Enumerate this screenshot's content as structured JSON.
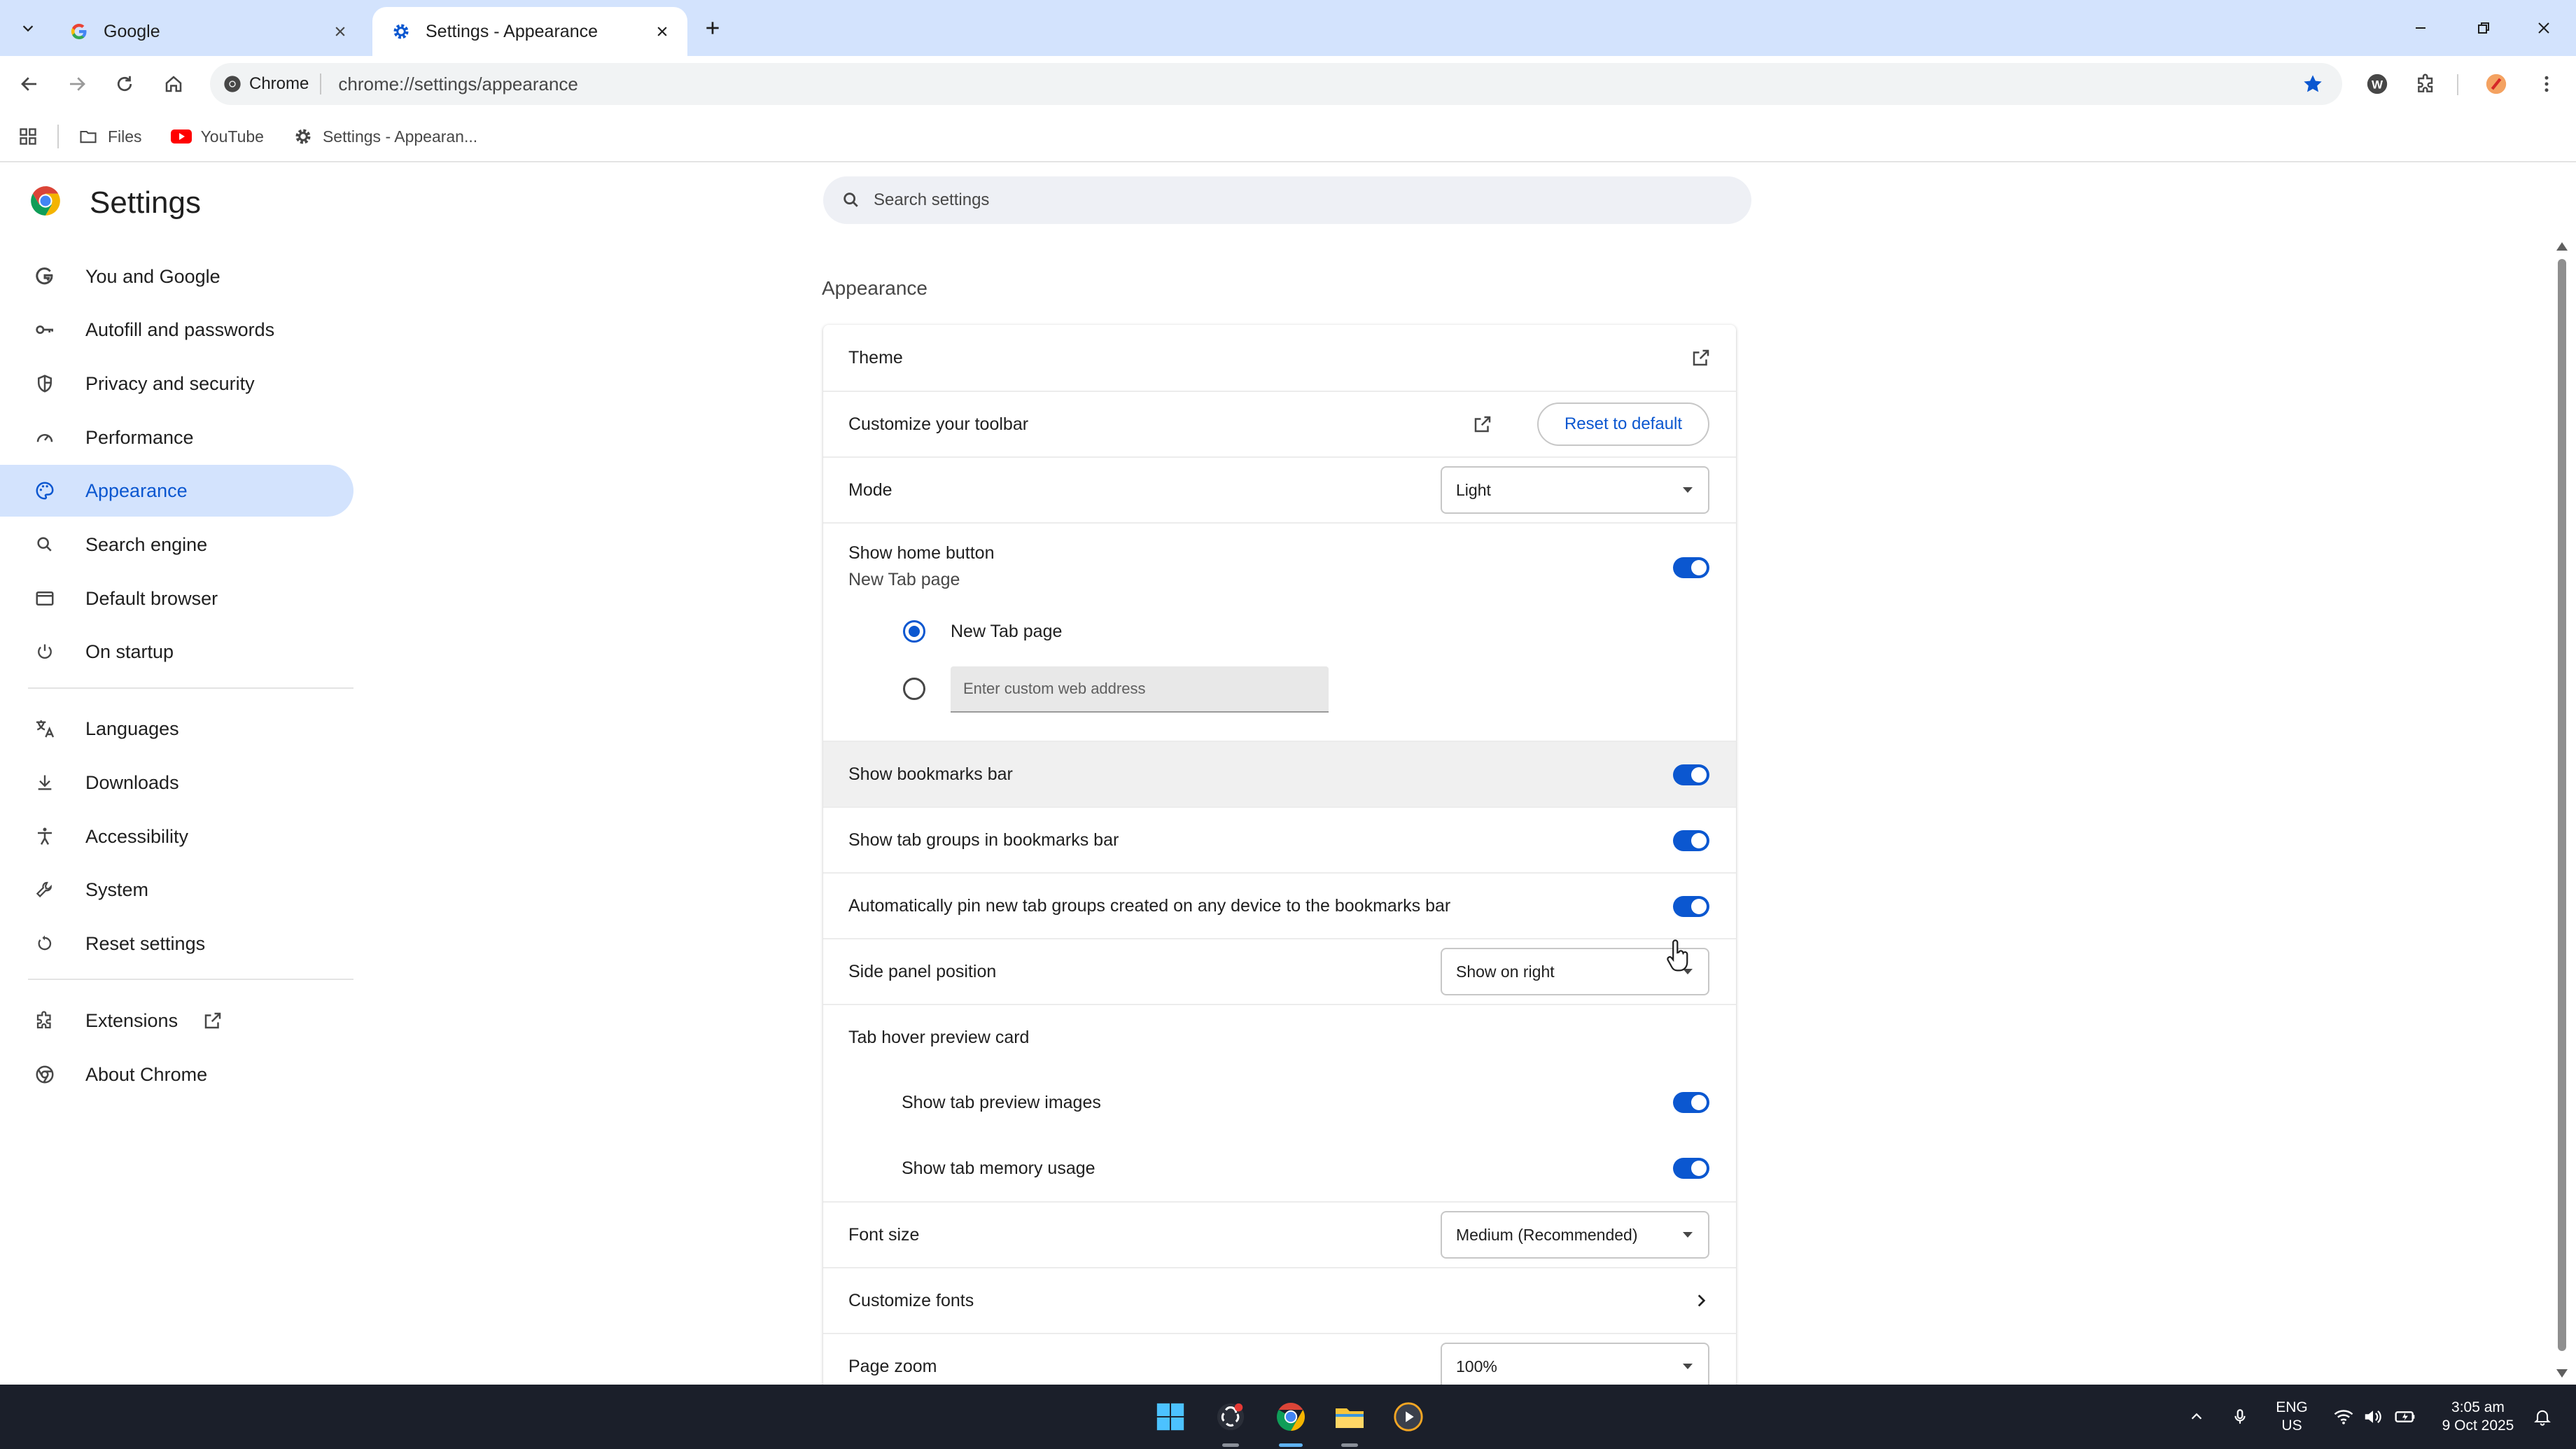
{
  "browser": {
    "tabs": [
      {
        "title": "Google",
        "active": false
      },
      {
        "title": "Settings - Appearance",
        "active": true
      }
    ],
    "omnibox": {
      "chip": "Chrome",
      "url": "chrome://settings/appearance"
    },
    "bookmarks": [
      {
        "label": "Files",
        "icon": "folder-icon"
      },
      {
        "label": "YouTube",
        "icon": "youtube-icon"
      },
      {
        "label": "Settings - Appearan...",
        "icon": "gear-icon"
      }
    ]
  },
  "settings": {
    "title": "Settings",
    "search_placeholder": "Search settings",
    "nav": [
      {
        "label": "You and Google",
        "icon": "google-g-icon"
      },
      {
        "label": "Autofill and passwords",
        "icon": "key-icon"
      },
      {
        "label": "Privacy and security",
        "icon": "shield-icon"
      },
      {
        "label": "Performance",
        "icon": "speedometer-icon"
      },
      {
        "label": "Appearance",
        "icon": "palette-icon",
        "active": true
      },
      {
        "label": "Search engine",
        "icon": "search-icon"
      },
      {
        "label": "Default browser",
        "icon": "browser-window-icon"
      },
      {
        "label": "On startup",
        "icon": "power-icon"
      },
      {
        "label": "Languages",
        "icon": "translate-icon"
      },
      {
        "label": "Downloads",
        "icon": "download-icon"
      },
      {
        "label": "Accessibility",
        "icon": "accessibility-icon"
      },
      {
        "label": "System",
        "icon": "wrench-icon"
      },
      {
        "label": "Reset settings",
        "icon": "reset-icon"
      },
      {
        "label": "Extensions",
        "icon": "puzzle-icon"
      },
      {
        "label": "About Chrome",
        "icon": "chrome-icon"
      }
    ],
    "section_title": "Appearance",
    "appearance": {
      "theme": "Theme",
      "customize_toolbar": "Customize your toolbar",
      "reset_to_default": "Reset to default",
      "mode_label": "Mode",
      "mode_value": "Light",
      "show_home_button": "Show home button",
      "home_button_sub": "New Tab page",
      "radio_new_tab": "New Tab page",
      "custom_address_placeholder": "Enter custom web address",
      "show_bookmarks_bar": "Show bookmarks bar",
      "show_tab_groups": "Show tab groups in bookmarks bar",
      "auto_pin": "Automatically pin new tab groups created on any device to the bookmarks bar",
      "side_panel_label": "Side panel position",
      "side_panel_value": "Show on right",
      "tab_hover_preview": "Tab hover preview card",
      "show_tab_preview_images": "Show tab preview images",
      "show_tab_memory_usage": "Show tab memory usage",
      "font_size_label": "Font size",
      "font_size_value": "Medium (Recommended)",
      "customize_fonts": "Customize fonts",
      "page_zoom_label": "Page zoom",
      "page_zoom_value": "100%"
    },
    "toggles": {
      "home_button": true,
      "bookmarks_bar": true,
      "tab_groups": true,
      "auto_pin": true,
      "tab_preview_images": true,
      "tab_memory_usage": true
    }
  },
  "taskbar": {
    "lang_top": "ENG",
    "lang_bottom": "US",
    "time": "3:05 am",
    "date": "9 Oct 2025"
  },
  "colors": {
    "accent": "#0b57d0",
    "nav_active_bg": "#d3e3fd",
    "tabstrip_bg": "#d3e3fd"
  }
}
